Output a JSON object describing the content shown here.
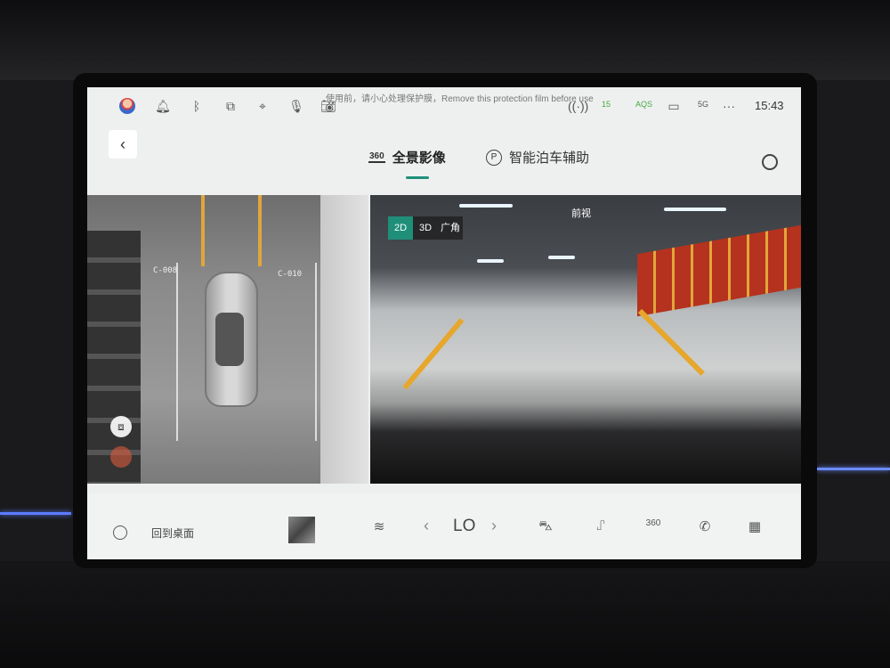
{
  "status_bar": {
    "notice_text": "使用前，请小心处理保护膜，Remove this protection film before use",
    "time": "15:43",
    "pm_label": "15",
    "aqs_label": "AQS",
    "signal_label": "5G",
    "more_label": "···"
  },
  "header": {
    "back_label": "‹",
    "tabs": [
      {
        "icon_label": "360",
        "label": "全景影像"
      },
      {
        "icon_label": "P",
        "label": "智能泊车辅助"
      }
    ]
  },
  "camera": {
    "birdseye_codes": [
      "C-008",
      "C-010"
    ],
    "mode_buttons": [
      "2D",
      "3D",
      "广角"
    ],
    "active_mode": "2D",
    "view_label": "前视"
  },
  "dock": {
    "home_label": "回到桌面",
    "temp": "LO",
    "temp_left": "‹",
    "temp_right": "›",
    "icons": [
      "defrost-icon",
      "car-icon",
      "seat-icon",
      "360-view-icon",
      "phone-icon",
      "apps-grid-icon"
    ]
  },
  "colors": {
    "accent": "#1f8f7a",
    "lane_yellow": "#e6a72c"
  }
}
